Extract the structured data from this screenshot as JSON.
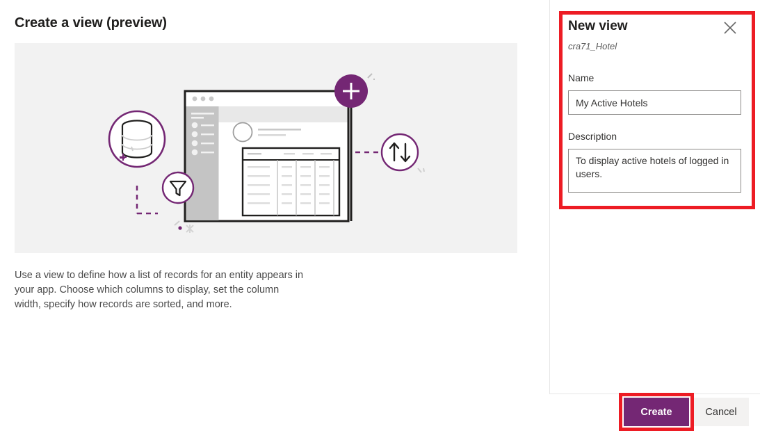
{
  "page": {
    "title": "Create a view (preview)",
    "body_copy": "Use a view to define how a list of records for an entity appears in your app. Choose which columns to display, set the column width, specify how records are sorted, and more."
  },
  "illustration": {
    "name": "create-view-illustration",
    "background_color": "#f2f2f2",
    "accent_color": "#742774",
    "icons": [
      "database-icon",
      "filter-funnel-icon",
      "add-plus-icon",
      "sort-arrows-icon",
      "app-window-mockup",
      "sparkle-icon"
    ]
  },
  "panel": {
    "title": "New view",
    "subtitle": "cra71_Hotel",
    "close_label": "Close",
    "fields": {
      "name": {
        "label": "Name",
        "value": "My Active Hotels",
        "placeholder": ""
      },
      "description": {
        "label": "Description",
        "value": "To display active hotels of logged in users.",
        "placeholder": ""
      }
    }
  },
  "footer": {
    "create_label": "Create",
    "cancel_label": "Cancel"
  },
  "annotations": {
    "color": "#ED1C24",
    "boxes": [
      "new-view-panel",
      "create-button"
    ]
  },
  "colors": {
    "accent_purple": "#742774",
    "annotation_red": "#ED1C24",
    "panel_gray": "#f2f2f2",
    "button_gray": "#f3f2f1"
  }
}
